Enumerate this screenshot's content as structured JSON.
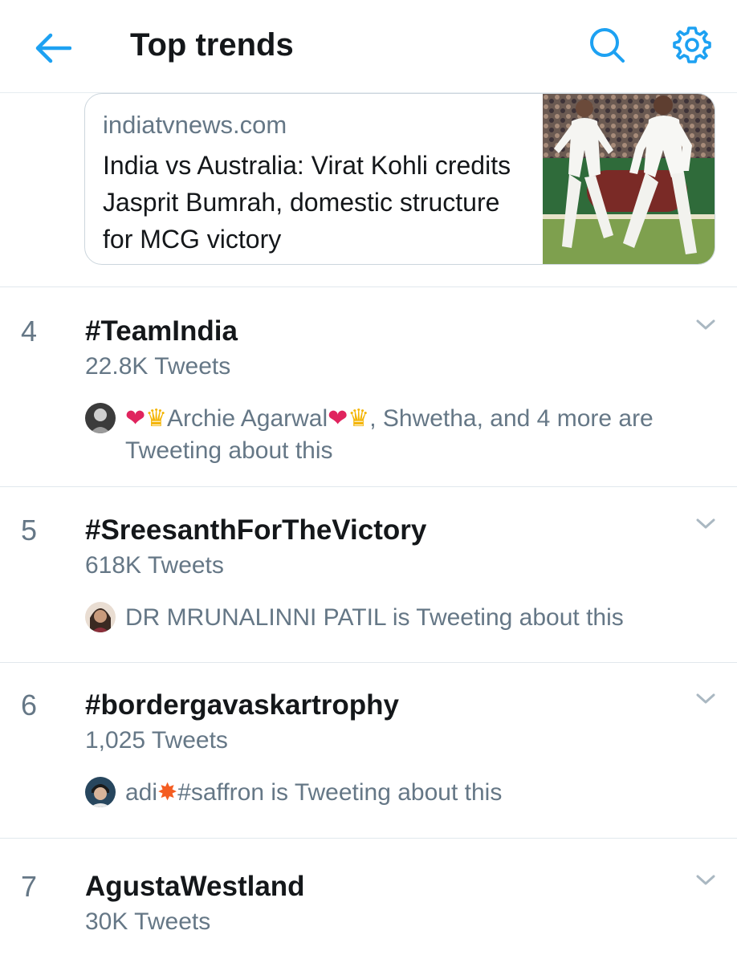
{
  "header": {
    "title": "Top trends",
    "back_icon": "arrow-left-icon",
    "search_icon": "search-icon",
    "settings_icon": "gear-icon",
    "accent_color": "#1da1f2"
  },
  "news_card": {
    "source": "indiatvnews.com",
    "headline": "India vs Australia: Virat Kohli credits Jasprit Bumrah, domestic structure for MCG victory"
  },
  "trends": [
    {
      "rank": "4",
      "name": "#TeamIndia",
      "count": "22.8K Tweets",
      "social_name1": "Archie Agarwal",
      "social_rest": ", Shwetha, and 4 more are Tweeting about this"
    },
    {
      "rank": "5",
      "name": "#SreesanthForTheVictory",
      "count": "618K Tweets",
      "social_text": "DR  MRUNALINNI PATIL is Tweeting about this"
    },
    {
      "rank": "6",
      "name": "#bordergavaskartrophy",
      "count": "1,025 Tweets",
      "social_prefix": "adi",
      "social_rest": "#saffron is Tweeting about this"
    },
    {
      "rank": "7",
      "name": "AgustaWestland",
      "count": "30K Tweets"
    }
  ]
}
